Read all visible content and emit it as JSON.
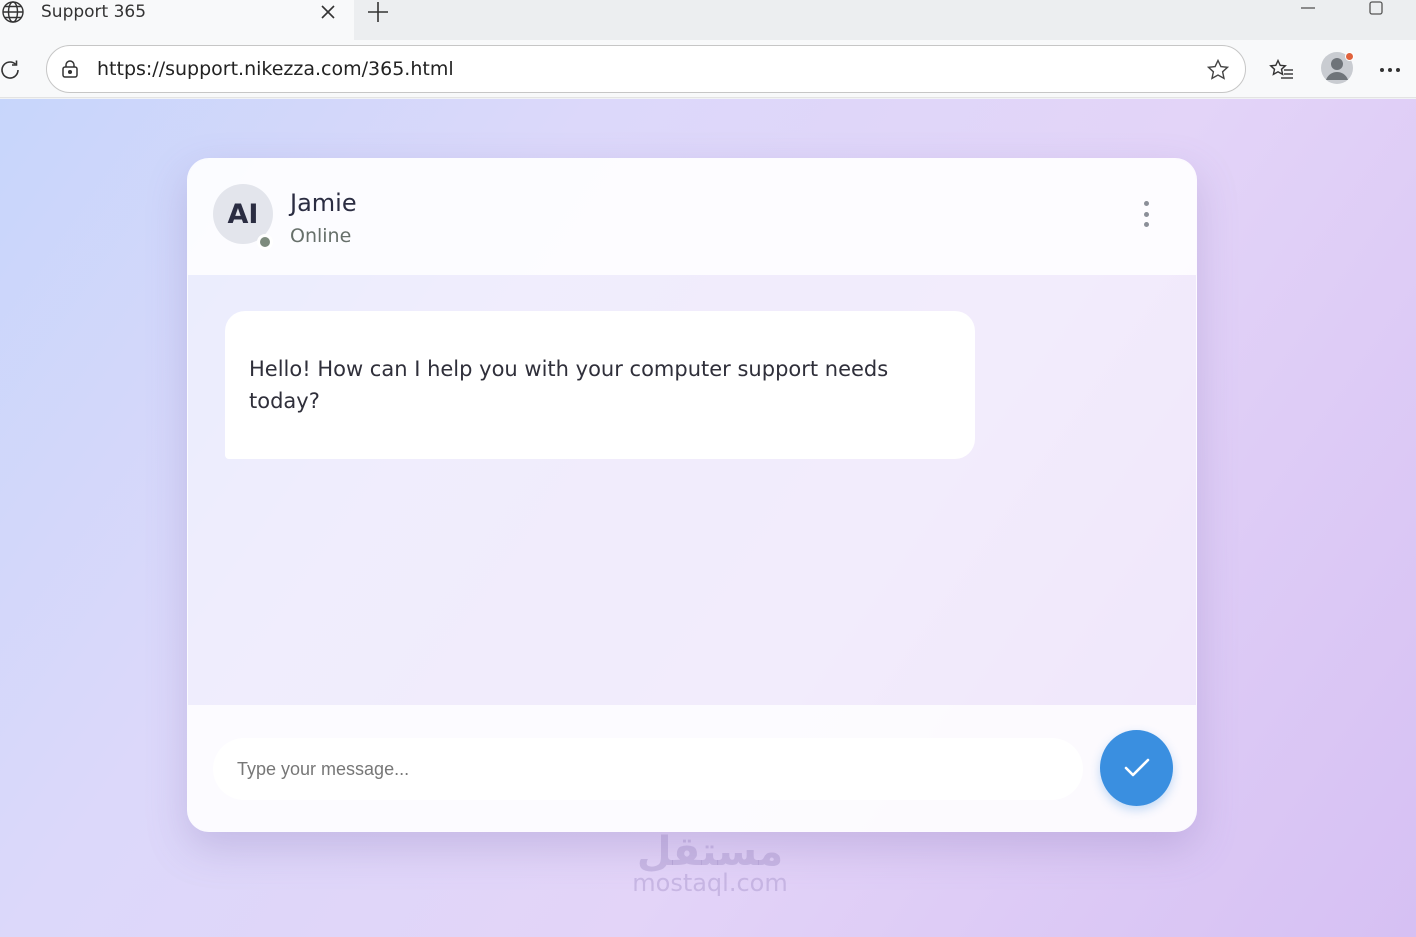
{
  "browser": {
    "tab_title": "Support 365",
    "url": "https://support.nikezza.com/365.html"
  },
  "chat": {
    "agent_avatar_initials": "AI",
    "agent_name": "Jamie",
    "agent_status": "Online",
    "messages": [
      {
        "sender": "agent",
        "text": "Hello! How can I help you with your computer support needs today?"
      }
    ],
    "input_placeholder": "Type your message..."
  },
  "watermark": {
    "logo": "مستقل",
    "text": "mostaql.com"
  },
  "colors": {
    "send_button": "#3a8fe0",
    "status_dot": "#7d8b7d",
    "profile_badge": "#e0623c"
  }
}
